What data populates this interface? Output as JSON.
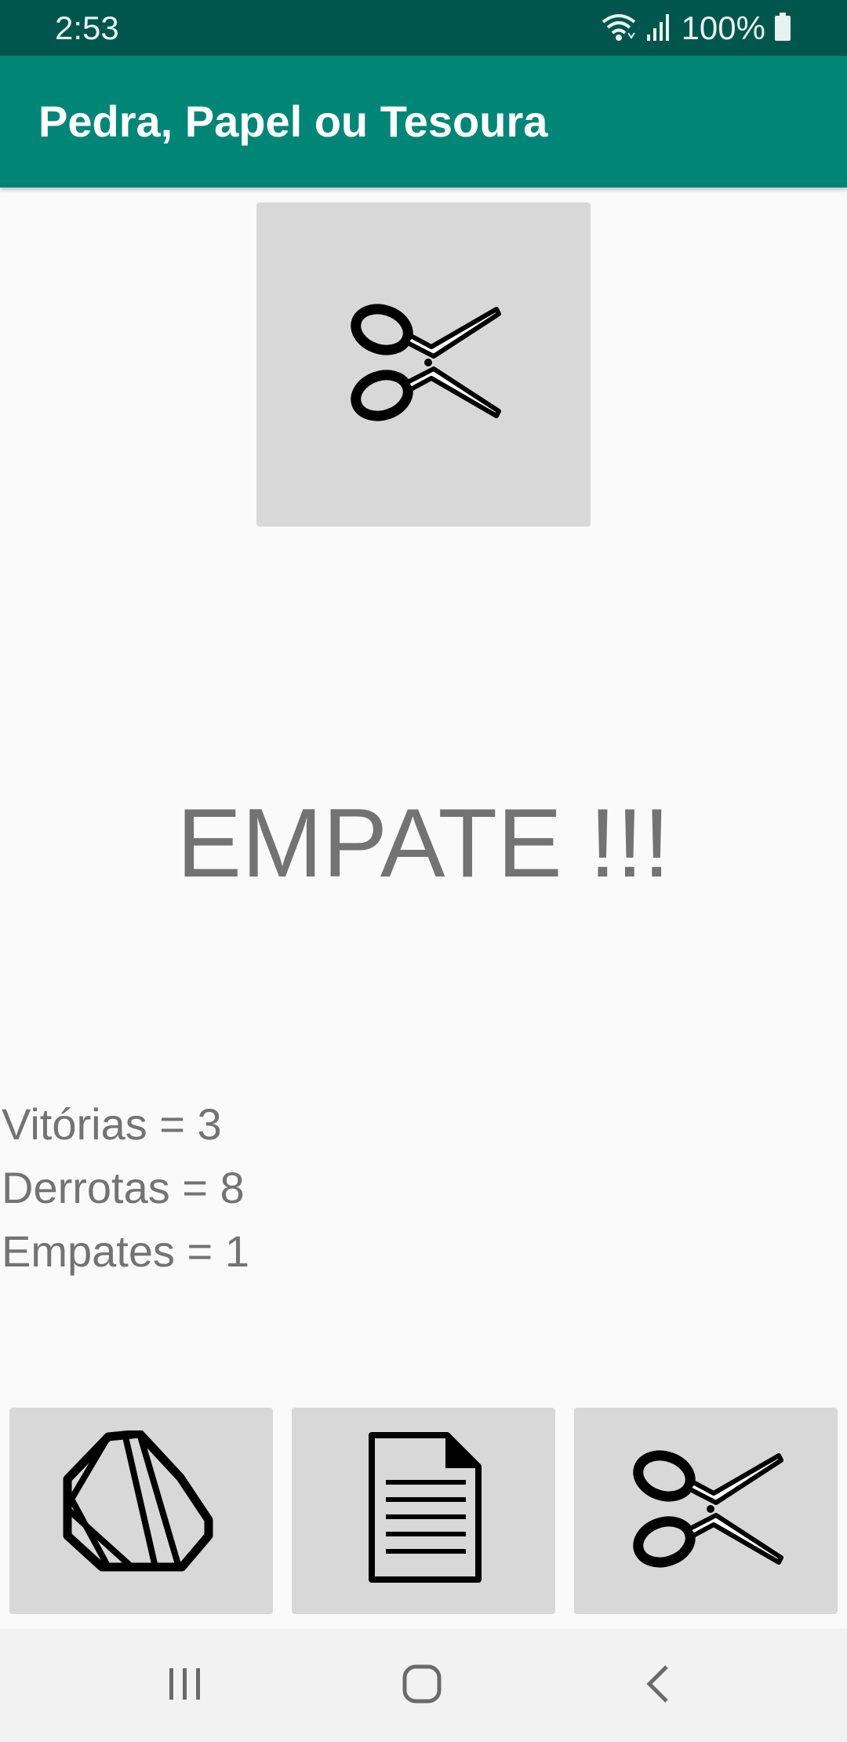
{
  "status_bar": {
    "time": "2:53",
    "battery": "100%",
    "icons": [
      "wifi-icon",
      "signal-icon",
      "battery-icon"
    ]
  },
  "app_bar": {
    "title": "Pedra, Papel ou Tesoura"
  },
  "app_choice": {
    "icon": "scissors-icon"
  },
  "result": {
    "text": "EMPATE !!!"
  },
  "score": {
    "wins": "Vitórias = 3",
    "losses": "Derrotas = 8",
    "draws": "Empates = 1"
  },
  "options": [
    {
      "name": "rock",
      "icon": "rock-icon"
    },
    {
      "name": "paper",
      "icon": "paper-icon"
    },
    {
      "name": "scissors",
      "icon": "scissors-icon"
    }
  ],
  "nav_bar": {
    "icons": [
      "recent-apps-icon",
      "home-icon",
      "back-icon"
    ]
  },
  "colors": {
    "status_bar": "#00564c",
    "app_bar": "#008577",
    "background": "#fafafa",
    "tile": "#d7d8d7",
    "text_gray": "#737373",
    "nav_bar": "#f2f2f2"
  }
}
